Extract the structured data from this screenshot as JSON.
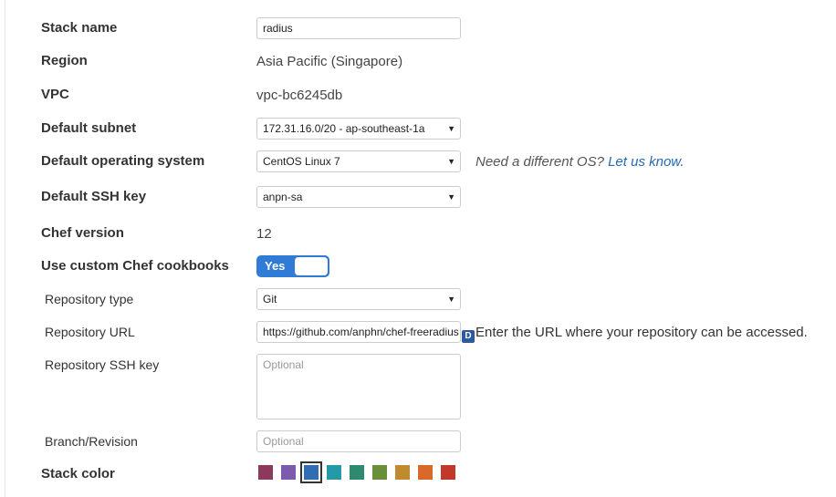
{
  "fields": {
    "stack_name": {
      "label": "Stack name",
      "value": "radius"
    },
    "region": {
      "label": "Region",
      "value": "Asia Pacific (Singapore)"
    },
    "vpc": {
      "label": "VPC",
      "value": "vpc-bc6245db"
    },
    "default_subnet": {
      "label": "Default subnet",
      "value": "172.31.16.0/20 - ap-southeast-1a"
    },
    "default_os": {
      "label": "Default operating system",
      "value": "CentOS Linux 7",
      "hint_text": "Need a different OS?",
      "hint_link": "Let us know."
    },
    "default_ssh_key": {
      "label": "Default SSH key",
      "value": "anpn-sa"
    },
    "chef_version": {
      "label": "Chef version",
      "value": "12"
    },
    "custom_cookbooks": {
      "label": "Use custom Chef cookbooks",
      "toggle_label": "Yes"
    },
    "repository_type": {
      "label": "Repository type",
      "value": "Git"
    },
    "repository_url": {
      "label": "Repository URL",
      "value": "https://github.com/anphn/chef-freeradius",
      "badge": "D",
      "hint_text": "Enter the URL where your repository can be accessed."
    },
    "repository_ssh_key": {
      "label": "Repository SSH key",
      "placeholder": "Optional"
    },
    "branch_revision": {
      "label": "Branch/Revision",
      "placeholder": "Optional"
    },
    "stack_color": {
      "label": "Stack color",
      "swatches": [
        "#8b3a5e",
        "#7b5ab0",
        "#2f6db5",
        "#2599a8",
        "#2e8a6e",
        "#6a8f3a",
        "#c08a2e",
        "#d8692a",
        "#c0392b"
      ],
      "selected_index": 2
    }
  },
  "colors": {
    "link": "#2469b3",
    "toggle": "#2f7bd6"
  }
}
